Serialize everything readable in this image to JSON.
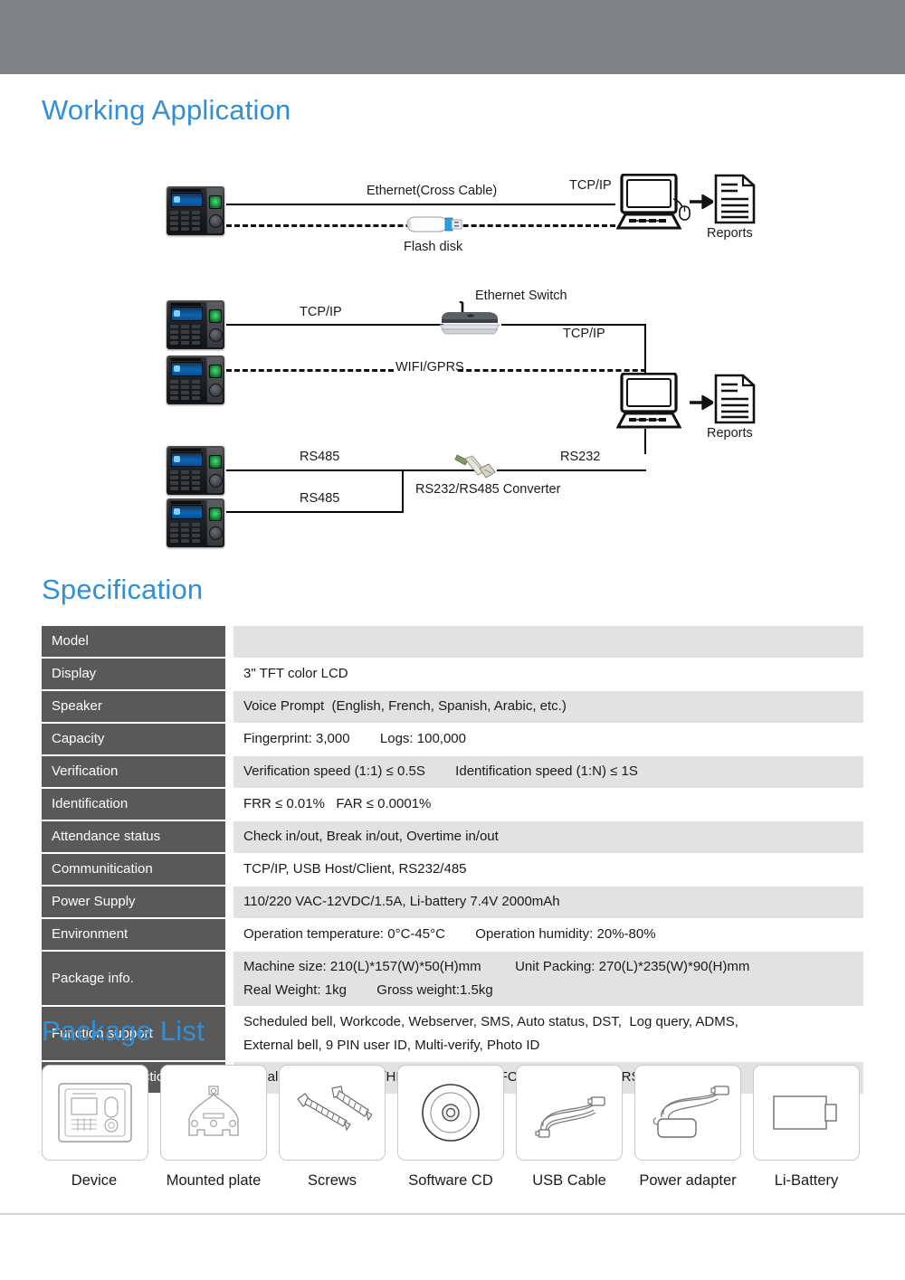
{
  "sections": {
    "working_application": "Working Application",
    "specification": "Specification",
    "package_list": "Package List"
  },
  "diagram": {
    "labels": {
      "ethernet_cross_cable": "Ethernet(Cross Cable)",
      "tcpip_1": "TCP/IP",
      "flash_disk": "Flash disk",
      "reports_1": "Reports",
      "tcpip_2": "TCP/IP",
      "ethernet_switch": "Ethernet Switch",
      "tcpip_3": "TCP/IP",
      "wifi_gprs": "WIFI/GPRS",
      "reports_2": "Reports",
      "rs485_1": "RS485",
      "rs485_2": "RS485",
      "rs232": "RS232",
      "converter": "RS232/RS485 Converter"
    }
  },
  "specification": {
    "rows": [
      {
        "key": "Model",
        "values": [
          ""
        ]
      },
      {
        "key": "Display",
        "values": [
          "3\" TFT color LCD"
        ]
      },
      {
        "key": "Speaker",
        "values": [
          "Voice Prompt  (English, French, Spanish, Arabic, etc.)"
        ]
      },
      {
        "key": "Capacity",
        "values": [
          "Fingerprint: 3,000        Logs: 100,000"
        ]
      },
      {
        "key": "Verification",
        "values": [
          "Verification speed (1:1) ≤ 0.5S        Identification speed (1:N) ≤ 1S"
        ]
      },
      {
        "key": "Identification",
        "values": [
          "FRR ≤ 0.01%   FAR ≤ 0.0001%"
        ]
      },
      {
        "key": "Attendance status",
        "values": [
          "Check in/out, Break in/out, Overtime in/out"
        ]
      },
      {
        "key": "Communitication",
        "values": [
          "TCP/IP, USB Host/Client, RS232/485"
        ]
      },
      {
        "key": "Power Supply",
        "values": [
          "110/220 VAC-12VDC/1.5A, Li-battery 7.4V 2000mAh"
        ]
      },
      {
        "key": "Environment",
        "values": [
          "Operation temperature: 0°C-45°C        Operation humidity: 20%-80%"
        ]
      },
      {
        "key": "Package info.",
        "values": [
          "Machine size: 210(L)*157(W)*50(H)mm         Unit Packing: 270(L)*235(W)*90(H)mm",
          "Real Weight: 1kg        Gross weight:1.5kg"
        ]
      },
      {
        "key": "Function support",
        "values": [
          "Scheduled bell, Workcode, Webserver, SMS, Auto status, DST,  Log query, ADMS,",
          "External bell, 9 PIN user ID, Multi-verify, Photo ID"
        ]
      },
      {
        "key": "Customize Function",
        "values": [
          "Serial printer, ID/Mifare/HID card reader, NFC reader, WiFi, GPRS"
        ]
      }
    ]
  },
  "package_list": {
    "items": [
      {
        "label": "Device",
        "icon": "device-terminal-icon"
      },
      {
        "label": "Mounted plate",
        "icon": "mounting-plate-icon"
      },
      {
        "label": "Screws",
        "icon": "screws-icon"
      },
      {
        "label": "Software CD",
        "icon": "cd-disc-icon"
      },
      {
        "label": "USB Cable",
        "icon": "usb-cable-icon"
      },
      {
        "label": "Power adapter",
        "icon": "power-adapter-icon"
      },
      {
        "label": "Li-Battery",
        "icon": "battery-icon"
      }
    ]
  },
  "colors": {
    "heading": "#2f8fd8",
    "topbar": "#808184",
    "table_key_bg": "#595959",
    "table_row_alt": "#e2e2e2"
  }
}
